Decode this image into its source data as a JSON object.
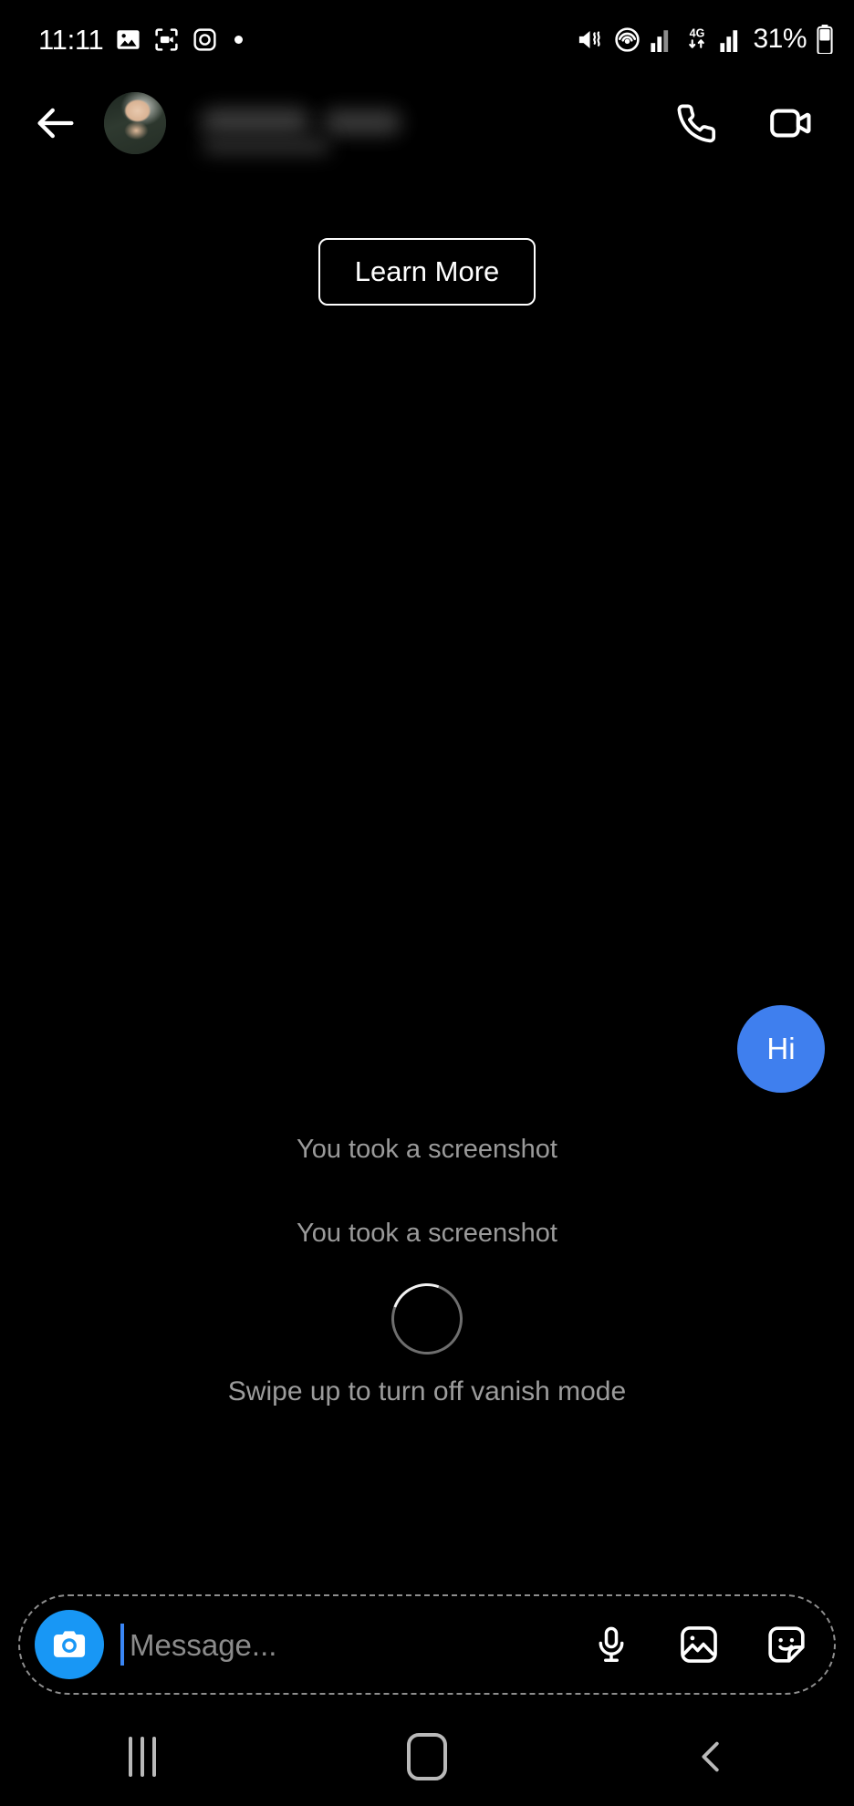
{
  "status_bar": {
    "time": "11:11",
    "battery_percent": "31%",
    "network_type": "4G",
    "icons": [
      {
        "name": "gallery-icon",
        "label": "Gallery"
      },
      {
        "name": "screen-recorder-icon",
        "label": "Screen recorder"
      },
      {
        "name": "instagram-icon",
        "label": "Instagram"
      },
      {
        "name": "notification-dot-icon",
        "label": "More notifications"
      },
      {
        "name": "sound-vibrate-off-icon",
        "label": "Vibrate / mute"
      },
      {
        "name": "hotspot-icon",
        "label": "Hotspot"
      },
      {
        "name": "signal-bars-icon",
        "label": "Signal"
      },
      {
        "name": "data-transfer-icon",
        "label": "4G data"
      },
      {
        "name": "signal-bars-2-icon",
        "label": "Signal 2"
      },
      {
        "name": "battery-icon",
        "label": "Battery"
      }
    ]
  },
  "chat_header": {
    "back_label": "Back",
    "username": "",
    "username_redacted": true,
    "avatar_label": "Profile photo",
    "audio_call_label": "Audio call",
    "video_call_label": "Video call"
  },
  "thread": {
    "learn_more_label": "Learn More",
    "messages": [
      {
        "type": "outgoing",
        "text": "Hi"
      },
      {
        "type": "system",
        "text": "You took a screenshot"
      },
      {
        "type": "system",
        "text": "You took a screenshot"
      }
    ],
    "system_note_1": "You took a screenshot",
    "system_note_2": "You took a screenshot",
    "vanish_hint": "Swipe up to turn off vanish mode",
    "spinner_label": "Loading"
  },
  "input_bar": {
    "camera_label": "Open camera",
    "placeholder": "Message...",
    "value": "",
    "mic_label": "Voice message",
    "gallery_label": "Photo gallery",
    "sticker_label": "Stickers",
    "vanish_mode_active": true
  },
  "nav_bar": {
    "recents_label": "Recent apps",
    "home_label": "Home",
    "back_label": "Back"
  },
  "colors": {
    "background": "#000000",
    "bubble_blue": "#3F7FEE",
    "camera_blue": "#1897F5",
    "caret_blue": "#3A86F5",
    "system_text": "#9A9A9A",
    "nav_icon": "#B9B9B9",
    "dashed_border": "#8E8E8E"
  }
}
